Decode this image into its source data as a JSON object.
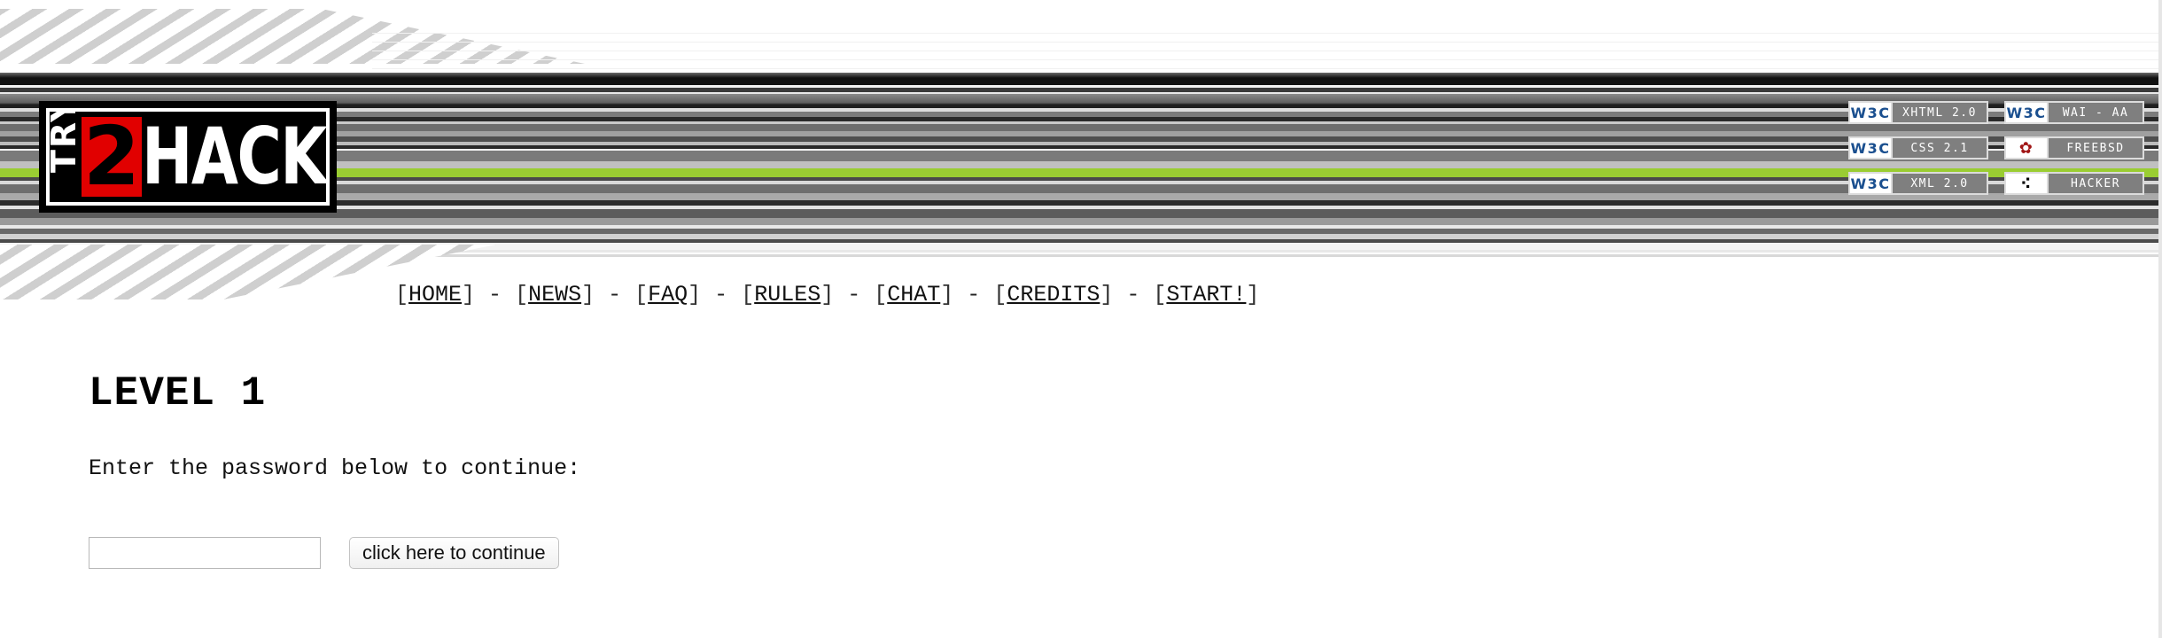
{
  "logo": {
    "try": "TRY",
    "two": "2",
    "hack": "HACK"
  },
  "badges": [
    {
      "logo": "W3C",
      "text": "XHTML 2.0",
      "icon": "w3c-icon"
    },
    {
      "logo": "W3C",
      "text": "WAI - AA",
      "icon": "w3c-icon"
    },
    {
      "logo": "W3C",
      "text": "CSS 2.1",
      "icon": "w3c-icon"
    },
    {
      "logo": "✿",
      "text": "FREEBSD",
      "icon": "freebsd-icon"
    },
    {
      "logo": "W3C",
      "text": "XML 2.0",
      "icon": "w3c-icon"
    },
    {
      "logo": "⠪",
      "text": "HACKER",
      "icon": "hacker-glider-icon"
    }
  ],
  "nav": {
    "open": "[",
    "close": "]",
    "sep": " - ",
    "items": [
      "HOME",
      "NEWS",
      "FAQ",
      "RULES",
      "CHAT",
      "CREDITS",
      "START!"
    ]
  },
  "main": {
    "title": "LEVEL 1",
    "instructions": "Enter the password below to continue:",
    "password_value": "",
    "password_placeholder": "",
    "button_label": "click here to continue"
  },
  "colors": {
    "accent_green": "#9acd32",
    "logo_red": "#e10000",
    "w3c_blue": "#1a4f8f"
  }
}
